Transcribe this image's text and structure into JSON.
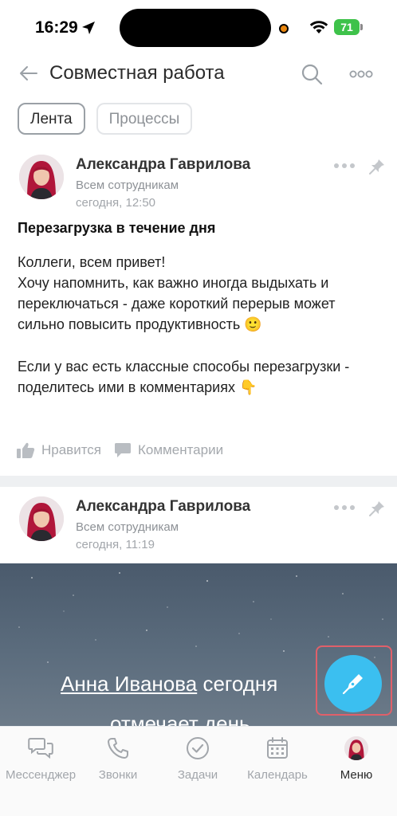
{
  "status": {
    "time": "16:29",
    "battery": "71"
  },
  "header": {
    "title": "Совместная работа"
  },
  "tabs": [
    {
      "label": "Лента",
      "active": true
    },
    {
      "label": "Процессы",
      "active": false
    }
  ],
  "posts": [
    {
      "author": "Александра Гаврилова",
      "audience": "Всем сотрудникам",
      "time": "сегодня, 12:50",
      "heading": "Перезагрузка в течение дня",
      "paragraphs": [
        "Коллеги, всем привет!",
        "Хочу напомнить, как важно иногда выдыхать и переключаться - даже короткий перерыв может сильно повысить продуктивность",
        "Если у вас есть классные способы перезагрузки - поделитесь ими в комментариях"
      ],
      "emoji_smile": "🙂",
      "emoji_point": "👇",
      "like_label": "Нравится",
      "comments_label": "Комментарии"
    },
    {
      "author": "Александра Гаврилова",
      "audience": "Всем сотрудникам",
      "time": "сегодня, 11:19"
    }
  ],
  "banner": {
    "person_link": "Анна Иванова",
    "line1_rest": " сегодня",
    "line2": "отмечает день"
  },
  "bottom_nav": [
    {
      "label": "Мессенджер",
      "icon": "messenger-icon"
    },
    {
      "label": "Звонки",
      "icon": "phone-icon"
    },
    {
      "label": "Задачи",
      "icon": "check-circle-icon"
    },
    {
      "label": "Календарь",
      "icon": "calendar-icon"
    },
    {
      "label": "Меню",
      "icon": "avatar",
      "active": true
    }
  ],
  "colors": {
    "accent": "#3bbff0",
    "fab_highlight": "#e0606a",
    "battery": "#3ec24a"
  }
}
